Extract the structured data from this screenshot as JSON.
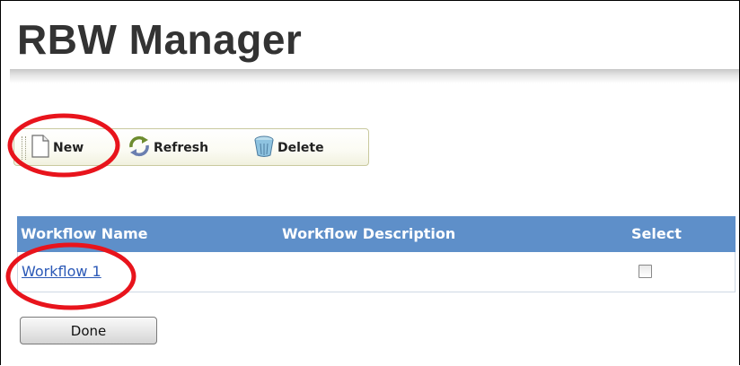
{
  "page": {
    "title": "RBW Manager"
  },
  "toolbar": {
    "buttons": [
      {
        "label": "New",
        "icon": "new-document-icon"
      },
      {
        "label": "Refresh",
        "icon": "refresh-icon"
      },
      {
        "label": "Delete",
        "icon": "delete-bin-icon"
      }
    ]
  },
  "grid": {
    "columns": [
      "Workflow Name",
      "Workflow Description",
      "Select"
    ],
    "rows": [
      {
        "name": "Workflow 1",
        "description": "",
        "selected": false
      }
    ],
    "header_color": "#5e8fc9"
  },
  "footer": {
    "done_label": "Done"
  },
  "annotations": {
    "highlight_color": "#e8141c",
    "shape": "red-ellipse"
  }
}
